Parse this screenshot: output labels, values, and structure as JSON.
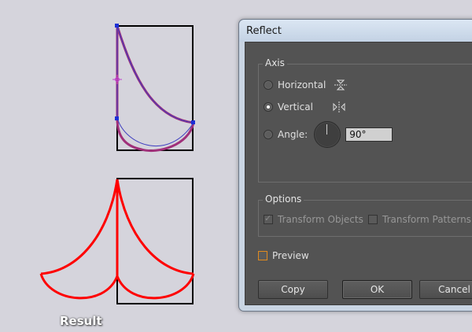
{
  "canvas": {
    "result_label": "Result"
  },
  "dialog": {
    "title": "Reflect",
    "axis_group": {
      "legend": "Axis",
      "horizontal_label": "Horizontal",
      "vertical_label": "Vertical",
      "angle_label": "Angle:",
      "angle_value": "90°",
      "selected": "Vertical"
    },
    "options_group": {
      "legend": "Options",
      "transform_objects_label": "Transform Objects",
      "transform_objects_checked": true,
      "transform_patterns_label": "Transform Patterns",
      "transform_patterns_checked": false
    },
    "preview": {
      "label": "Preview",
      "checked": false
    },
    "buttons": {
      "copy": "Copy",
      "ok": "OK",
      "cancel": "Cancel"
    }
  },
  "colors": {
    "artwork_stroke": "#000000",
    "selected_path": "#8a1f7a",
    "selection_anchor": "#1c2fd6",
    "result_stroke": "#ff0000",
    "dialog_bg": "#535353",
    "preview_focus": "#e08a1e"
  }
}
